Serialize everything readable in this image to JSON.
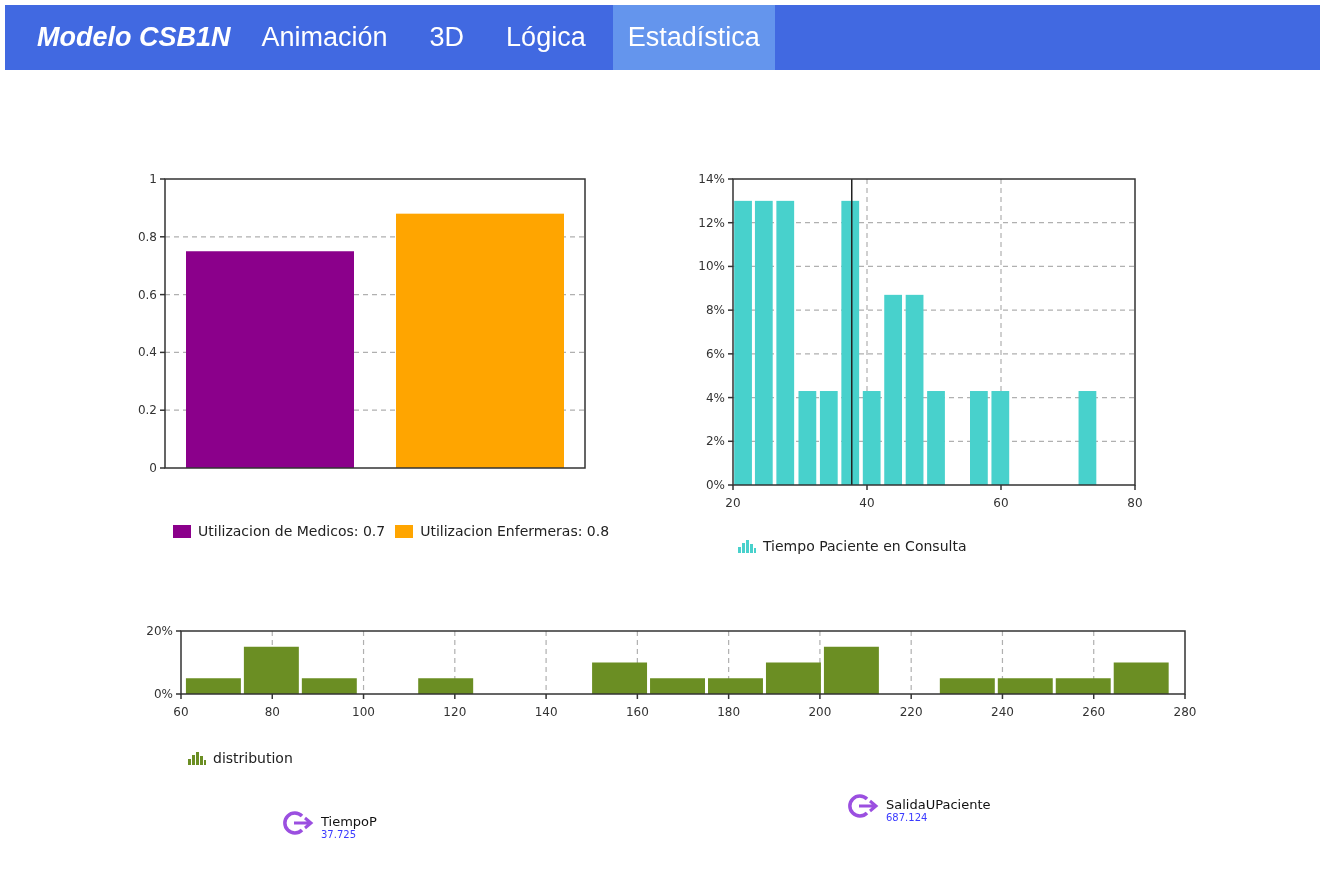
{
  "header": {
    "title": "Modelo CSB1N",
    "tabs": [
      {
        "label": "Animación",
        "selected": false
      },
      {
        "label": "3D",
        "selected": false
      },
      {
        "label": "Lógica",
        "selected": false
      },
      {
        "label": "Estadística",
        "selected": true
      }
    ]
  },
  "charts": [
    {
      "chart_data": {
        "type": "bar",
        "grid": true,
        "ylim": [
          0,
          1
        ],
        "yticks": [
          0,
          0.2,
          0.4,
          0.6,
          0.8,
          1
        ],
        "series": [
          {
            "name": "Utilizacion de Medicos: 0.7",
            "color": "#8b008b",
            "values": [
              0.75
            ]
          },
          {
            "name": "Utilizacion Enfermeras: 0.8",
            "color": "#ffa500",
            "values": [
              0.88
            ]
          }
        ]
      }
    },
    {
      "chart_data": {
        "type": "bar",
        "grid": true,
        "xlim": [
          20,
          80
        ],
        "ylim": [
          0,
          14
        ],
        "xticks": [
          20,
          40,
          60,
          80
        ],
        "yticks": [
          {
            "value": 0,
            "label": "0%"
          },
          {
            "value": 2,
            "label": "2%"
          },
          {
            "value": 4,
            "label": "4%"
          },
          {
            "value": 6,
            "label": "6%"
          },
          {
            "value": 8,
            "label": "8%"
          },
          {
            "value": 10,
            "label": "10%"
          },
          {
            "value": 12,
            "label": "12%"
          },
          {
            "value": 14,
            "label": "14%"
          }
        ],
        "x": [
          21.5,
          24.6,
          27.8,
          31.1,
          34.3,
          37.5,
          40.7,
          43.9,
          47.1,
          50.3,
          56.7,
          59.9,
          72.9
        ],
        "series": [
          {
            "name": "Tiempo Paciente en Consulta",
            "color": "#48d1cc",
            "values": [
              13.0,
              13.0,
              13.0,
              4.3,
              4.3,
              13.0,
              4.3,
              8.7,
              8.7,
              4.3,
              4.3,
              4.3,
              4.3
            ]
          }
        ],
        "ref_lines": [
          {
            "axis": "x",
            "value": 37.725
          }
        ]
      }
    },
    {
      "chart_data": {
        "type": "bar",
        "grid": true,
        "xlim": [
          60,
          280
        ],
        "ylim": [
          0,
          20
        ],
        "xticks": [
          60,
          80,
          100,
          120,
          140,
          160,
          180,
          200,
          220,
          240,
          260,
          280
        ],
        "yticks": [
          {
            "value": 0,
            "label": "0%"
          },
          {
            "value": 20,
            "label": "20%"
          }
        ],
        "x": [
          67.1,
          79.8,
          92.5,
          118.0,
          156.1,
          168.8,
          181.5,
          194.2,
          206.9,
          232.3,
          245.0,
          257.7,
          270.4
        ],
        "series": [
          {
            "name": "distribution",
            "color": "#6b8e23",
            "values": [
              5,
              15,
              5,
              5,
              10,
              5,
              5,
              10,
              15,
              5,
              5,
              5,
              10
            ]
          }
        ]
      }
    }
  ],
  "statistics": [
    {
      "name": "TiempoP",
      "value": "37.725"
    },
    {
      "name": "SalidaUPaciente",
      "value": "687.124"
    }
  ]
}
